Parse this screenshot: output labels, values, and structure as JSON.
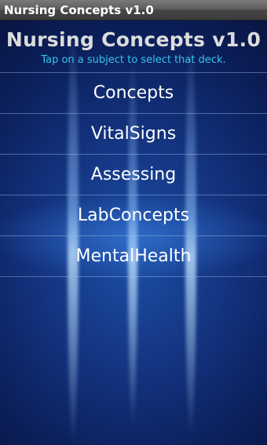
{
  "window": {
    "title": "Nursing Concepts v1.0"
  },
  "header": {
    "title": "Nursing Concepts v1.0",
    "subtitle": "Tap on a subject to select that deck."
  },
  "menu": {
    "items": [
      {
        "label": "Concepts"
      },
      {
        "label": "VitalSigns"
      },
      {
        "label": "Assessing"
      },
      {
        "label": "LabConcepts"
      },
      {
        "label": "MentalHealth"
      }
    ]
  },
  "colors": {
    "subtitle": "#35c4ee",
    "background": "#12307a"
  }
}
